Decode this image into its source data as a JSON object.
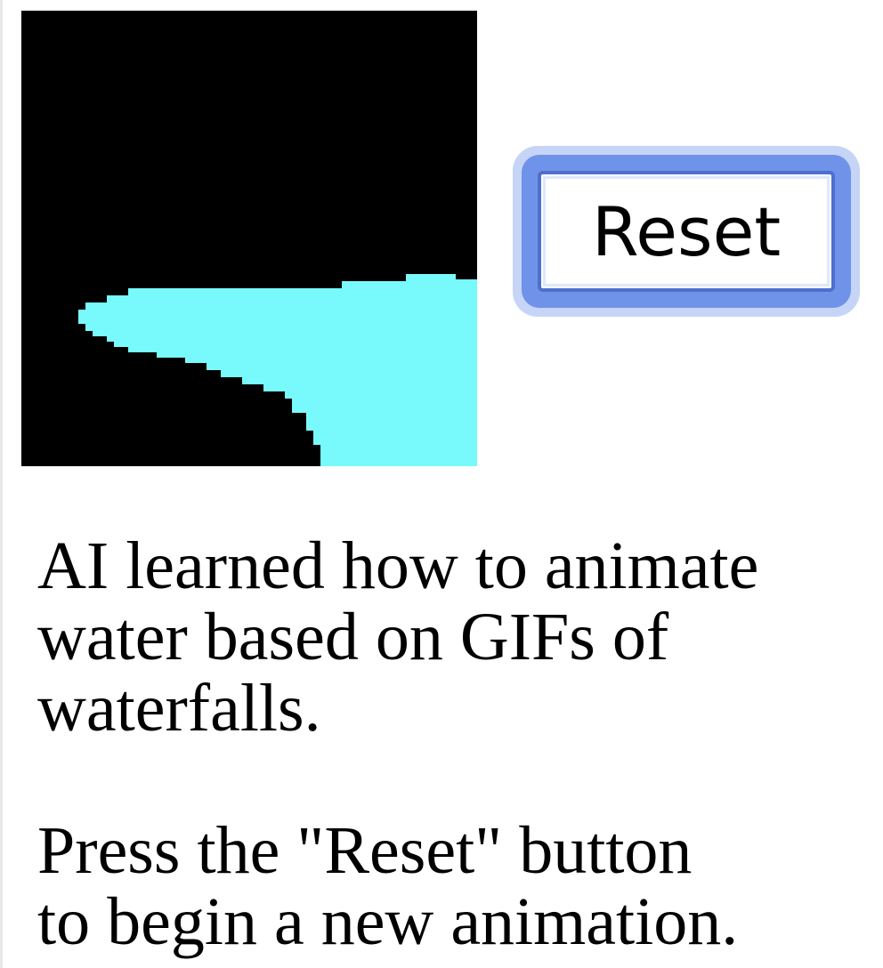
{
  "animation": {
    "background_color": "#000000",
    "water_color": "#78fafc"
  },
  "controls": {
    "reset_label": "Reset"
  },
  "caption": {
    "line1": "AI learned how to animate",
    "line2": "water based on GIFs of",
    "line3": "waterfalls.",
    "line4": "Press the \"Reset\" button",
    "line5": "to begin a new animation."
  }
}
